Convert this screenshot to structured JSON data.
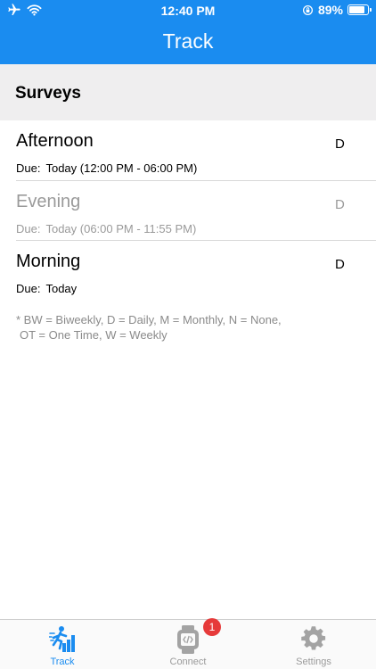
{
  "status_bar": {
    "time": "12:40 PM",
    "battery_text": "89%",
    "battery_level": 0.89
  },
  "nav": {
    "title": "Track"
  },
  "section": {
    "title": "Surveys"
  },
  "surveys": [
    {
      "name": "Afternoon",
      "due_label": "Due:",
      "due_value": "Today (12:00 PM - 06:00 PM)",
      "frequency": "D"
    },
    {
      "name": "Evening",
      "due_label": "Due:",
      "due_value": "Today (06:00 PM - 11:55 PM)",
      "frequency": "D"
    },
    {
      "name": "Morning",
      "due_label": "Due:",
      "due_value": "Today",
      "frequency": "D"
    }
  ],
  "legend": {
    "line1": "* BW = Biweekly, D = Daily, M = Monthly, N = None,",
    "line2": "OT = One Time, W = Weekly"
  },
  "tabs": [
    {
      "label": "Track",
      "icon": "running-person-icon"
    },
    {
      "label": "Connect",
      "icon": "smartwatch-icon",
      "badge": "1"
    },
    {
      "label": "Settings",
      "icon": "gear-icon"
    }
  ],
  "colors": {
    "primary": "#1a8cf0",
    "tab_active": "#1a8cf0",
    "tab_inactive": "#9a9a9a",
    "badge": "#e63a3a"
  }
}
